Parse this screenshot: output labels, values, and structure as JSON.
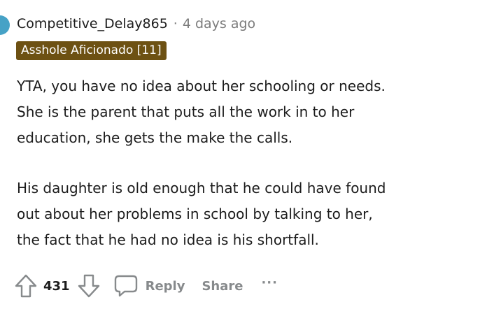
{
  "comment": {
    "author": "Competitive_Delay865",
    "separator": "·",
    "timestamp": "4 days ago",
    "flair": "Asshole Aficionado [11]",
    "paragraphs": [
      [
        "YTA, you have no idea about her schooling or needs.",
        "She is the parent that puts all the work in to her",
        "education, she gets the make the calls."
      ],
      [
        "His daughter is old enough that he could have found",
        "out about her problems in school by talking to her,",
        "the fact that he had no idea is his shortfall."
      ]
    ]
  },
  "actions": {
    "upvote_icon": "upvote-arrow-icon",
    "vote_count": "431",
    "downvote_icon": "downvote-arrow-icon",
    "reply_icon": "speech-bubble-icon",
    "reply_label": "Reply",
    "share_label": "Share",
    "more_label": "···"
  },
  "colors": {
    "flair_bg": "#6d5113",
    "meta_gray": "#7c7c7c",
    "action_gray": "#878a8c",
    "avatar": "#46a2c6"
  }
}
